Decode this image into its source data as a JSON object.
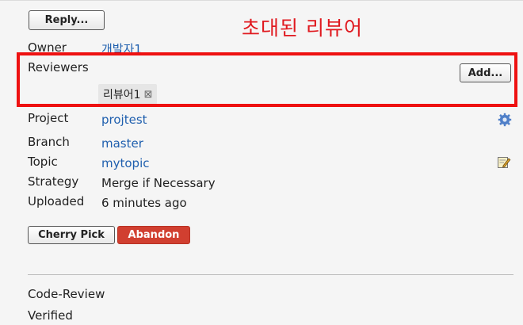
{
  "buttons": {
    "reply": "Reply...",
    "add": "Add...",
    "cherry_pick": "Cherry Pick",
    "abandon": "Abandon"
  },
  "annotation": {
    "callout": "초대된 리뷰어"
  },
  "info": {
    "owner": {
      "label": "Owner",
      "value": "개발자1"
    },
    "reviewers": {
      "label": "Reviewers",
      "chips": [
        {
          "name": "리뷰어1",
          "remove": "⊠"
        }
      ]
    },
    "project": {
      "label": "Project",
      "value": "projtest"
    },
    "branch": {
      "label": "Branch",
      "value": "master"
    },
    "topic": {
      "label": "Topic",
      "value": "mytopic"
    },
    "strategy": {
      "label": "Strategy",
      "value": "Merge if Necessary"
    },
    "uploaded": {
      "label": "Uploaded",
      "value": "6 minutes ago"
    }
  },
  "labels": {
    "items": [
      "Code-Review",
      "Verified"
    ]
  },
  "icons": {
    "project_settings": "gear-icon",
    "topic_edit": "edit-icon"
  },
  "colors": {
    "link": "#1f5fae",
    "abandon": "#d13f30",
    "annotation": "#e0191f"
  }
}
